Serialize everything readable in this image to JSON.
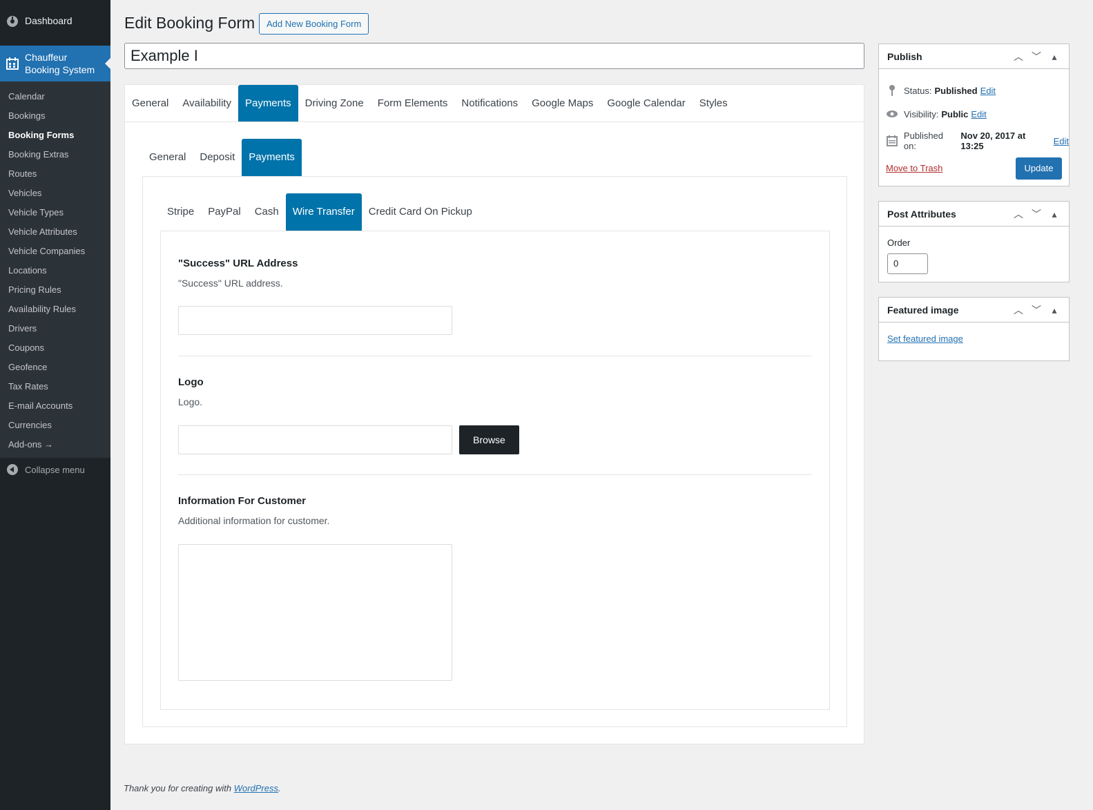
{
  "sidebar": {
    "dashboard": "Dashboard",
    "plugin_line1": "Chauffeur",
    "plugin_line2": "Booking System",
    "items": [
      "Calendar",
      "Bookings",
      "Booking Forms",
      "Booking Extras",
      "Routes",
      "Vehicles",
      "Vehicle Types",
      "Vehicle Attributes",
      "Vehicle Companies",
      "Locations",
      "Pricing Rules",
      "Availability Rules",
      "Drivers",
      "Coupons",
      "Geofence",
      "Tax Rates",
      "E-mail Accounts",
      "Currencies",
      "Add-ons →"
    ],
    "current": "Booking Forms",
    "collapse": "Collapse menu"
  },
  "header": {
    "title": "Edit Booking Form",
    "add_new": "Add New Booking Form",
    "post_title": "Example I"
  },
  "tabs_main": [
    "General",
    "Availability",
    "Payments",
    "Driving Zone",
    "Form Elements",
    "Notifications",
    "Google Maps",
    "Google Calendar",
    "Styles"
  ],
  "tabs_main_active": "Payments",
  "tabs_sub": [
    "General",
    "Deposit",
    "Payments"
  ],
  "tabs_sub_active": "Payments",
  "tabs_gateway": [
    "Stripe",
    "PayPal",
    "Cash",
    "Wire Transfer",
    "Credit Card On Pickup"
  ],
  "tabs_gateway_active": "Wire Transfer",
  "fields": {
    "success_url": {
      "title": "\"Success\" URL Address",
      "desc": "\"Success\" URL address.",
      "value": ""
    },
    "logo": {
      "title": "Logo",
      "desc": "Logo.",
      "value": "",
      "browse": "Browse"
    },
    "info": {
      "title": "Information For Customer",
      "desc": "Additional information for customer.",
      "value": ""
    }
  },
  "publish": {
    "title": "Publish",
    "status_label": "Status:",
    "status_value": "Published",
    "visibility_label": "Visibility:",
    "visibility_value": "Public",
    "published_label": "Published on:",
    "published_value": "Nov 20, 2017 at 13:25",
    "edit": "Edit",
    "trash": "Move to Trash",
    "update": "Update"
  },
  "post_attributes": {
    "title": "Post Attributes",
    "order_label": "Order",
    "order_value": "0"
  },
  "featured_image": {
    "title": "Featured image",
    "link": "Set featured image"
  },
  "footer": {
    "text": "Thank you for creating with ",
    "link": "WordPress",
    "end": "."
  },
  "colors": {
    "accent": "#2271b1",
    "tab_active": "#0073aa",
    "sidebar": "#1d2327",
    "submenu": "#2c3338"
  }
}
